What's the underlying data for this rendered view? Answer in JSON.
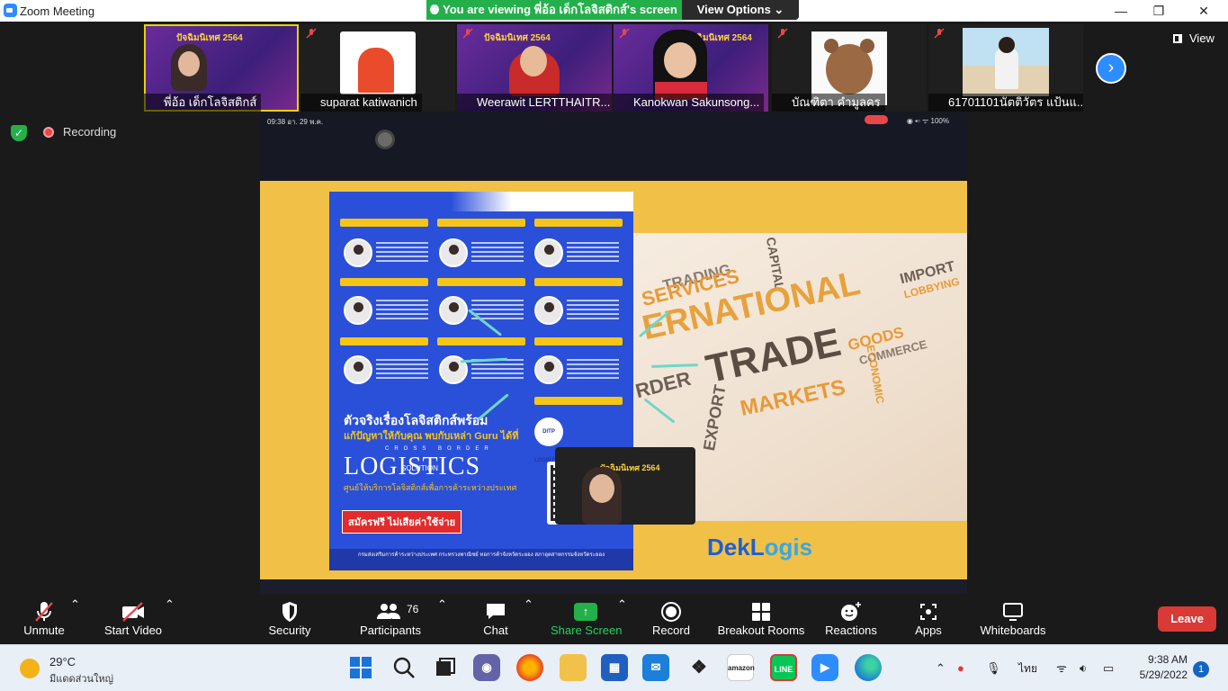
{
  "window": {
    "title": "Zoom Meeting",
    "controls": [
      "—",
      "❐",
      "✕"
    ]
  },
  "banner": {
    "viewing_text": "You are viewing พี่อ้อ เด็กโลจิสติกส์'s screen",
    "view_options_label": "View Options ⌄"
  },
  "view_button": "View",
  "recording_label": "Recording",
  "participants_strip": [
    {
      "name": "พี่อ้อ เด็กโลจิสติกส์",
      "active": true
    },
    {
      "name": "suparat katiwanich"
    },
    {
      "name": "Weerawit LERTTHAITR..."
    },
    {
      "name": "Kanokwan Sakunsong..."
    },
    {
      "name": "บัณฑิตา คำมูลคร"
    },
    {
      "name": "61701101นัตติวัตร แป้นแ..."
    }
  ],
  "thumb_overlay_text": "ปัจฉิมนิเทศ 2564",
  "phone": {
    "time": "09:38  อา. 29 พ.ค.",
    "status_right": "◉ ▪▫ ᯤ 100%"
  },
  "poster": {
    "headline": "ตัวจริงเรื่องโลจิสติกส์พร้อม",
    "subline": "แก้ปัญหาให้กับคุณ พบกับเหล่า Guru ได้ที่",
    "cross_border": "CROSS BORDER",
    "logistics": "LOGISTICS",
    "solution": "SOLUTION",
    "center_line": "ศูนย์ให้บริการโลจิสติกส์เพื่อการค้าระหว่างประเทศ",
    "register": "สมัครฟรี ไม่เสียค่าใช้จ่าย",
    "footer": "กรมส่งเสริมการค้าระหว่างประเทศ กระทรวงพาณิชย์ หอการค้าจังหวัดระยอง สภาอุตสาหกรรมจังหวัดระยอง",
    "badge": "DITP LOGISTICS"
  },
  "wordcloud": {
    "trade": "TRADE",
    "international": "ERNATIONAL",
    "markets": "MARKETS",
    "services": "SERVICES",
    "trading": "TRADING",
    "capital": "CAPITAL",
    "import": "IMPORT",
    "lobbying": "LOBBYING",
    "goods": "GOODS",
    "commerce": "COMMERCE",
    "export": "EXPORT",
    "order": "RDER",
    "economic": "ECONOMIC"
  },
  "dek_logis": {
    "part1": "DekL",
    "part2": "ogis"
  },
  "toolbar": {
    "unmute": "Unmute",
    "start_video": "Start Video",
    "security": "Security",
    "participants": "Participants",
    "participants_count": "76",
    "chat": "Chat",
    "share_screen": "Share Screen",
    "record": "Record",
    "breakout_rooms": "Breakout Rooms",
    "reactions": "Reactions",
    "apps": "Apps",
    "whiteboards": "Whiteboards",
    "leave": "Leave"
  },
  "taskbar": {
    "temperature": "29°C",
    "condition": "มีแดดส่วนใหญ่",
    "language": "ไทย",
    "time": "9:38 AM",
    "date": "5/29/2022",
    "notifications": "1",
    "amazon_label": "amazon",
    "line_label": "LINE"
  },
  "colors": {
    "zoom_blue": "#2d8cff",
    "banner_green": "#23b04a",
    "leave_red": "#d93a36",
    "slide_yellow": "#f0c047",
    "poster_blue": "#2a4fd8"
  }
}
